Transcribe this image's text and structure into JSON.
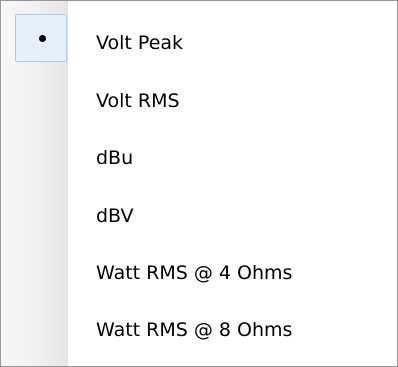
{
  "menu": {
    "selected_index": 0,
    "items": [
      {
        "label": "Volt Peak",
        "selected": true
      },
      {
        "label": "Volt RMS",
        "selected": false
      },
      {
        "label": "dBu",
        "selected": false
      },
      {
        "label": "dBV",
        "selected": false
      },
      {
        "label": "Watt RMS @ 4 Ohms",
        "selected": false
      },
      {
        "label": "Watt RMS @ 8 Ohms",
        "selected": false
      }
    ],
    "check_icon": "radio-bullet-icon"
  }
}
